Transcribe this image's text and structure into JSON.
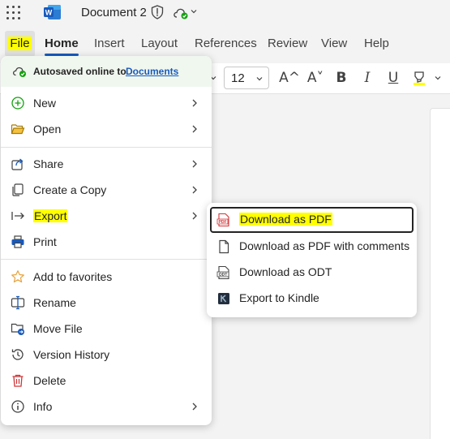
{
  "titlebar": {
    "doc_title": "Document 2"
  },
  "tabs": {
    "file": "File",
    "home": "Home",
    "insert": "Insert",
    "layout": "Layout",
    "references": "References",
    "review": "Review",
    "view": "View",
    "help": "Help"
  },
  "toolbar": {
    "font_size": "12",
    "grow_glyph": "A^",
    "shrink_glyph": "A˅",
    "bold_glyph": "B",
    "italic_glyph": "I",
    "underline_glyph": "U"
  },
  "file_menu": {
    "autosave_text": "Autosaved online to",
    "autosave_link": "Documents",
    "items": [
      {
        "label": "New",
        "icon": "plus-circle-icon"
      },
      {
        "label": "Open",
        "icon": "folder-open-icon"
      },
      {
        "label": "Share",
        "icon": "share-icon"
      },
      {
        "label": "Create a Copy",
        "icon": "copy-icon"
      },
      {
        "label": "Export",
        "icon": "export-arrow-icon"
      },
      {
        "label": "Print",
        "icon": "printer-icon"
      },
      {
        "label": "Add to favorites",
        "icon": "star-icon"
      },
      {
        "label": "Rename",
        "icon": "rename-icon"
      },
      {
        "label": "Move File",
        "icon": "move-file-icon"
      },
      {
        "label": "Version History",
        "icon": "history-icon"
      },
      {
        "label": "Delete",
        "icon": "trash-icon"
      },
      {
        "label": "Info",
        "icon": "info-icon"
      }
    ]
  },
  "export_submenu": {
    "items": [
      {
        "label": "Download as PDF",
        "icon": "pdf-icon"
      },
      {
        "label": "Download as PDF with comments",
        "icon": "pdf-comments-icon"
      },
      {
        "label": "Download as ODT",
        "icon": "odt-icon"
      },
      {
        "label": "Export to Kindle",
        "icon": "kindle-icon"
      }
    ]
  },
  "colors": {
    "accent": "#185abd",
    "highlight": "#ffff00",
    "autosave_bg": "#f0f7ef"
  }
}
